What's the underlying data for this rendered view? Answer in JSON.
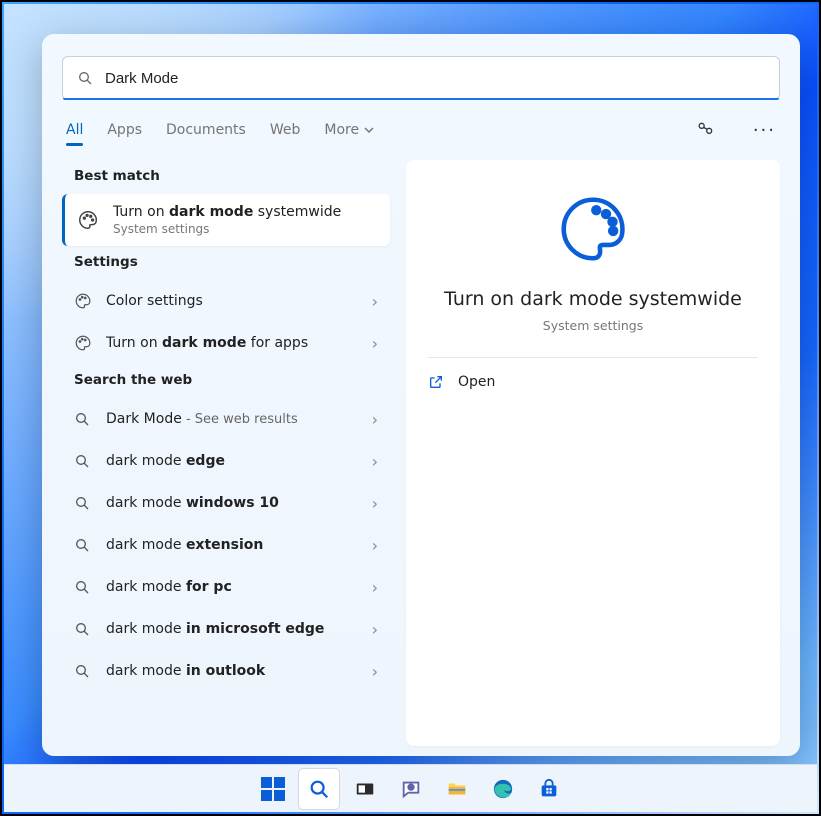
{
  "search": {
    "value": "Dark Mode"
  },
  "tabs": {
    "all": "All",
    "apps": "Apps",
    "documents": "Documents",
    "web": "Web",
    "more": "More"
  },
  "sections": {
    "best": "Best match",
    "settings": "Settings",
    "web": "Search the web"
  },
  "bestMatch": {
    "title_pre": "Turn on ",
    "title_bold": "dark mode",
    "title_post": " systemwide",
    "sub": "System settings"
  },
  "settingsItems": [
    {
      "label": "Color settings"
    },
    {
      "pre": "Turn on ",
      "bold": "dark mode",
      "post": " for apps"
    }
  ],
  "webItems": [
    {
      "pre": "Dark Mode",
      "suffix": " - See web results",
      "leadPlain": true
    },
    {
      "pre": "dark mode ",
      "bold": "edge"
    },
    {
      "pre": "dark mode ",
      "bold": "windows 10"
    },
    {
      "pre": "dark mode ",
      "bold": "extension"
    },
    {
      "pre": "dark mode ",
      "bold": "for pc"
    },
    {
      "pre": "dark mode ",
      "bold": "in microsoft edge"
    },
    {
      "pre": "dark mode ",
      "bold": "in outlook"
    }
  ],
  "preview": {
    "title": "Turn on dark mode systemwide",
    "sub": "System settings",
    "open": "Open"
  }
}
